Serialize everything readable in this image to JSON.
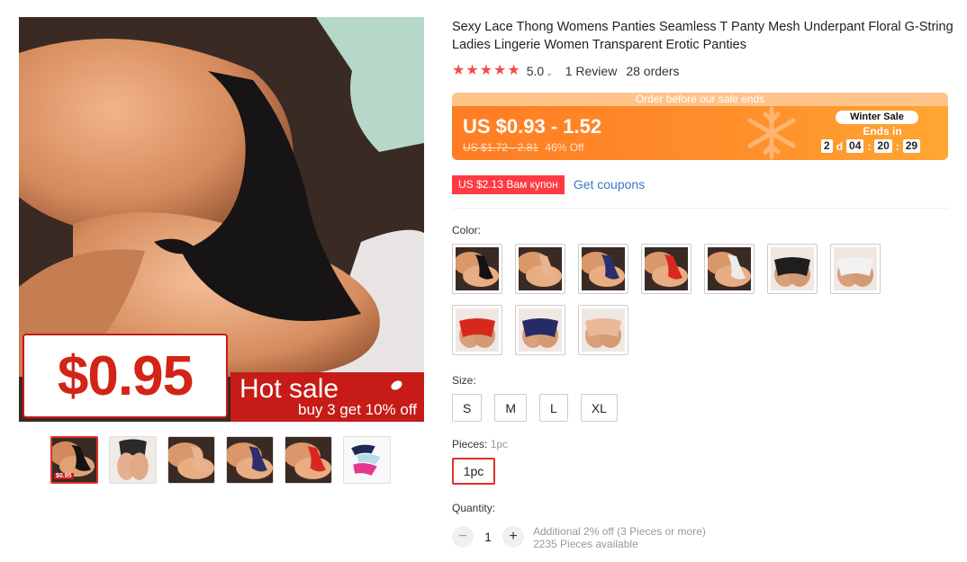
{
  "gallery": {
    "price_label": "$0.95",
    "hot_title": "Hot sale",
    "hot_sub": "buy 3 get 10% off",
    "thumb_badge": "$0.95",
    "thumbnails": [
      "black",
      "beige-back",
      "nude",
      "navy",
      "red",
      "multi-pack"
    ]
  },
  "product": {
    "title": "Sexy Lace Thong Womens Panties Seamless T Panty Mesh Underpant Floral G-String Ladies Lingerie Women Transparent Erotic Panties",
    "rating": "5.0",
    "reviews": "1 Review",
    "orders": "28 orders"
  },
  "sale": {
    "banner": "Order before our sale ends",
    "price": "US $0.93 - 1.52",
    "old_price": "US $1.72 - 2.81",
    "discount": "46% Off",
    "badge": "Winter Sale",
    "ends_in": "Ends in",
    "days": "2",
    "days_unit": "d",
    "hours": "04",
    "minutes": "20",
    "seconds": "29"
  },
  "coupon": {
    "tag": "US $2.13 Вам купон",
    "link": "Get coupons"
  },
  "color": {
    "label": "Color:",
    "swatches": [
      "black",
      "nude",
      "navy",
      "red",
      "white",
      "black-lace",
      "white-lace",
      "red-lace",
      "navy-lace",
      "nude-lace"
    ]
  },
  "size": {
    "label": "Size:",
    "options": [
      "S",
      "M",
      "L",
      "XL"
    ]
  },
  "pieces": {
    "label": "Pieces:",
    "selected": "1pc",
    "options": [
      "1pc"
    ]
  },
  "quantity": {
    "label": "Quantity:",
    "minus": "−",
    "value": "1",
    "plus": "+",
    "additional": "Additional 2% off (3 Pieces or more)",
    "available": "2235 Pieces available"
  },
  "colors_hex": {
    "accent": "#e0322a",
    "sale_orange": "#ff8f2b",
    "link": "#3a79c4",
    "star": "#f84a4a"
  }
}
